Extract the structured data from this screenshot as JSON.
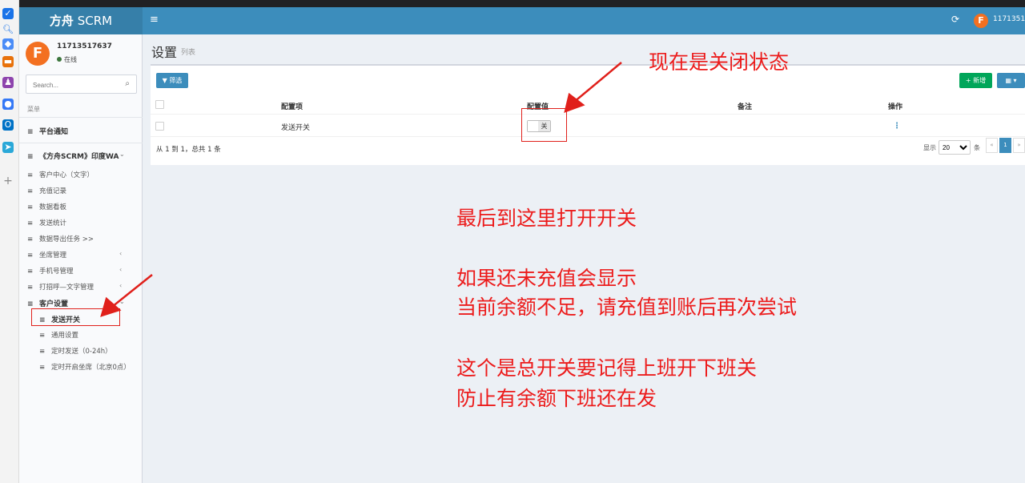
{
  "app": {
    "logo_bold": "方舟",
    "logo_rest": " SCRM",
    "user_id_short": "11713517637"
  },
  "sidebar": {
    "user_name": "11713517637",
    "status": "在线",
    "search_placeholder": "Search...",
    "menu_header": "菜单",
    "items": [
      {
        "label": "平台通知"
      },
      {
        "label": "《方舟SCRM》印度WA"
      },
      {
        "label": "客户中心（文字）"
      },
      {
        "label": "充值记录"
      },
      {
        "label": "数据看板"
      },
      {
        "label": "发送统计"
      },
      {
        "label": "数据导出任务 >>"
      },
      {
        "label": "坐席管理"
      },
      {
        "label": "手机号管理"
      },
      {
        "label": "打招呼—文字管理"
      },
      {
        "label": "客户设置"
      },
      {
        "label": "发送开关"
      },
      {
        "label": "通用设置"
      },
      {
        "label": "定时发送（0-24h）"
      },
      {
        "label": "定时开启坐席（北京0点）"
      }
    ]
  },
  "page": {
    "title": "设置",
    "subtitle": "列表"
  },
  "toolbar": {
    "filter_label": "筛选",
    "add_label": "新增"
  },
  "table": {
    "headers": [
      "配置项",
      "配置值",
      "备注",
      "操作"
    ],
    "rows": [
      {
        "item": "发送开关",
        "value": "关",
        "note": ""
      }
    ],
    "summary": "从 1 到 1，总共 1 条",
    "page_size_label": "显示",
    "page_size": "20",
    "page_size_unit": "条",
    "current_page": "1"
  },
  "annotations": {
    "top_note": "现在是关闭状态",
    "line1": "最后到这里打开开关",
    "line2": "如果还未充值会显示",
    "line3": "当前余额不足，请充值到账后再次尝试",
    "line4": "这个是总开关要记得上班开下班关",
    "line5": "防止有余额下班还在发",
    "color": "#ec1c1c"
  },
  "colors": {
    "brand_blue": "#3c8dbc",
    "logo_blue": "#367fa9",
    "success_green": "#00a65a",
    "avatar_orange": "#f37021"
  }
}
